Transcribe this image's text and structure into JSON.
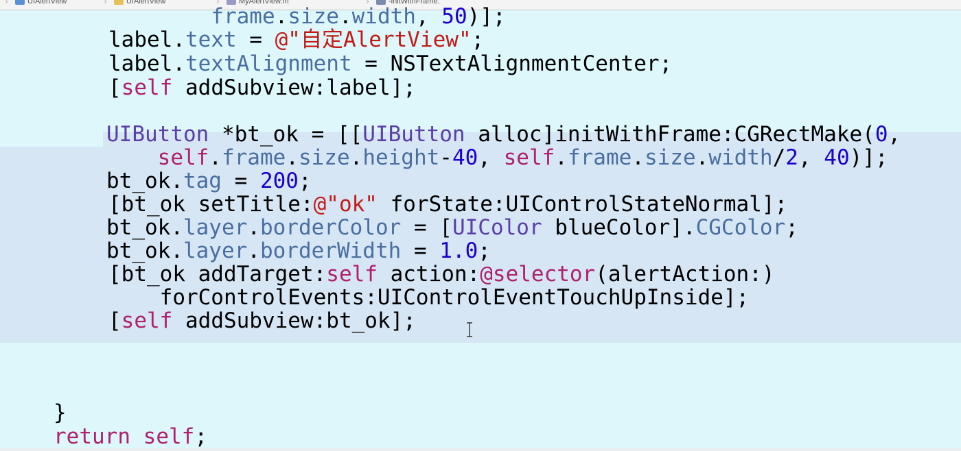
{
  "jumpbar": {
    "items": [
      {
        "label": "UIAlertView",
        "icon": "project-icon"
      },
      {
        "label": "UIAlertView",
        "icon": "folder-icon"
      },
      {
        "label": "MyAlertView.m",
        "icon": "m-file-icon"
      },
      {
        "label": "-initWithFrame:",
        "icon": "method-icon"
      }
    ]
  },
  "editor": {
    "lines": [
      {
        "tokens": [
          {
            "text": "        ",
            "kind": "plain"
          },
          {
            "text": "frame",
            "kind": "prop"
          },
          {
            "text": ".",
            "kind": "plain"
          },
          {
            "text": "size",
            "kind": "prop"
          },
          {
            "text": ".",
            "kind": "plain"
          },
          {
            "text": "width",
            "kind": "prop"
          },
          {
            "text": ", ",
            "kind": "plain"
          },
          {
            "text": "50",
            "kind": "num"
          },
          {
            "text": ")];",
            "kind": "plain"
          }
        ]
      },
      {
        "tokens": [
          {
            "text": "label.",
            "kind": "plain"
          },
          {
            "text": "text",
            "kind": "prop"
          },
          {
            "text": " = ",
            "kind": "plain"
          },
          {
            "text": "@\"自定AlertView\"",
            "kind": "str"
          },
          {
            "text": ";",
            "kind": "plain"
          }
        ]
      },
      {
        "tokens": [
          {
            "text": "label.",
            "kind": "plain"
          },
          {
            "text": "textAlignment",
            "kind": "prop"
          },
          {
            "text": " = NSTextAlignmentCenter;",
            "kind": "plain"
          }
        ]
      },
      {
        "tokens": [
          {
            "text": "[",
            "kind": "plain"
          },
          {
            "text": "self",
            "kind": "kw"
          },
          {
            "text": " addSubview:label];",
            "kind": "plain"
          }
        ]
      },
      {
        "tokens": []
      },
      {
        "tokens": [
          {
            "text": "UIButton",
            "kind": "type"
          },
          {
            "text": " *bt_ok = [[",
            "kind": "plain"
          },
          {
            "text": "UIButton",
            "kind": "type"
          },
          {
            "text": " alloc]initWithFrame:CGRectMake(",
            "kind": "plain"
          },
          {
            "text": "0",
            "kind": "num"
          },
          {
            "text": ",",
            "kind": "plain"
          }
        ]
      },
      {
        "tokens": [
          {
            "text": "    ",
            "kind": "plain"
          },
          {
            "text": "self",
            "kind": "kw"
          },
          {
            "text": ".",
            "kind": "plain"
          },
          {
            "text": "frame",
            "kind": "prop"
          },
          {
            "text": ".",
            "kind": "plain"
          },
          {
            "text": "size",
            "kind": "prop"
          },
          {
            "text": ".",
            "kind": "plain"
          },
          {
            "text": "height",
            "kind": "prop"
          },
          {
            "text": "-",
            "kind": "plain"
          },
          {
            "text": "40",
            "kind": "num"
          },
          {
            "text": ", ",
            "kind": "plain"
          },
          {
            "text": "self",
            "kind": "kw"
          },
          {
            "text": ".",
            "kind": "plain"
          },
          {
            "text": "frame",
            "kind": "prop"
          },
          {
            "text": ".",
            "kind": "plain"
          },
          {
            "text": "size",
            "kind": "prop"
          },
          {
            "text": ".",
            "kind": "plain"
          },
          {
            "text": "width",
            "kind": "prop"
          },
          {
            "text": "/",
            "kind": "plain"
          },
          {
            "text": "2",
            "kind": "num"
          },
          {
            "text": ", ",
            "kind": "plain"
          },
          {
            "text": "40",
            "kind": "num"
          },
          {
            "text": ")];",
            "kind": "plain"
          }
        ]
      },
      {
        "tokens": [
          {
            "text": "bt_ok.",
            "kind": "plain"
          },
          {
            "text": "tag",
            "kind": "prop"
          },
          {
            "text": " = ",
            "kind": "plain"
          },
          {
            "text": "200",
            "kind": "num"
          },
          {
            "text": ";",
            "kind": "plain"
          }
        ]
      },
      {
        "tokens": [
          {
            "text": "[bt_ok setTitle:",
            "kind": "plain"
          },
          {
            "text": "@\"ok\"",
            "kind": "str"
          },
          {
            "text": " forState:UIControlStateNormal];",
            "kind": "plain"
          }
        ]
      },
      {
        "tokens": [
          {
            "text": "bt_ok.",
            "kind": "plain"
          },
          {
            "text": "layer",
            "kind": "prop"
          },
          {
            "text": ".",
            "kind": "plain"
          },
          {
            "text": "borderColor",
            "kind": "prop"
          },
          {
            "text": " = [",
            "kind": "plain"
          },
          {
            "text": "UIColor",
            "kind": "type"
          },
          {
            "text": " blueColor].",
            "kind": "plain"
          },
          {
            "text": "CGColor",
            "kind": "prop"
          },
          {
            "text": ";",
            "kind": "plain"
          }
        ]
      },
      {
        "tokens": [
          {
            "text": "bt_ok.",
            "kind": "plain"
          },
          {
            "text": "layer",
            "kind": "prop"
          },
          {
            "text": ".",
            "kind": "plain"
          },
          {
            "text": "borderWidth",
            "kind": "prop"
          },
          {
            "text": " = ",
            "kind": "plain"
          },
          {
            "text": "1.0",
            "kind": "num"
          },
          {
            "text": ";",
            "kind": "plain"
          }
        ]
      },
      {
        "tokens": [
          {
            "text": "[bt_ok addTarget:",
            "kind": "plain"
          },
          {
            "text": "self",
            "kind": "kw"
          },
          {
            "text": " action:",
            "kind": "plain"
          },
          {
            "text": "@selector",
            "kind": "kw"
          },
          {
            "text": "(alertAction:)",
            "kind": "plain"
          }
        ]
      },
      {
        "tokens": [
          {
            "text": "    forControlEvents:UIControlEventTouchUpInside];",
            "kind": "plain"
          }
        ]
      },
      {
        "tokens": [
          {
            "text": "[",
            "kind": "plain"
          },
          {
            "text": "self",
            "kind": "kw"
          },
          {
            "text": " addSubview:bt_ok];",
            "kind": "plain"
          }
        ]
      },
      {
        "tokens": []
      },
      {
        "tokens": []
      },
      {
        "tokens": []
      },
      {
        "tokens": [
          {
            "text": "}",
            "kind": "plain"
          }
        ]
      },
      {
        "tokens": [
          {
            "text": "return",
            "kind": "kw"
          },
          {
            "text": " ",
            "kind": "plain"
          },
          {
            "text": "self",
            "kind": "kw"
          },
          {
            "text": ";",
            "kind": "plain"
          }
        ]
      }
    ]
  },
  "colors": {
    "background": "#ddf7fb",
    "selection": "#d6e6f5",
    "keyword": "#b0206d",
    "property": "#4a6ea0",
    "type": "#5b3ea6",
    "string": "#c41a16",
    "number": "#1c00cf"
  },
  "icons": {
    "cursor": "i-beam-cursor-icon"
  }
}
